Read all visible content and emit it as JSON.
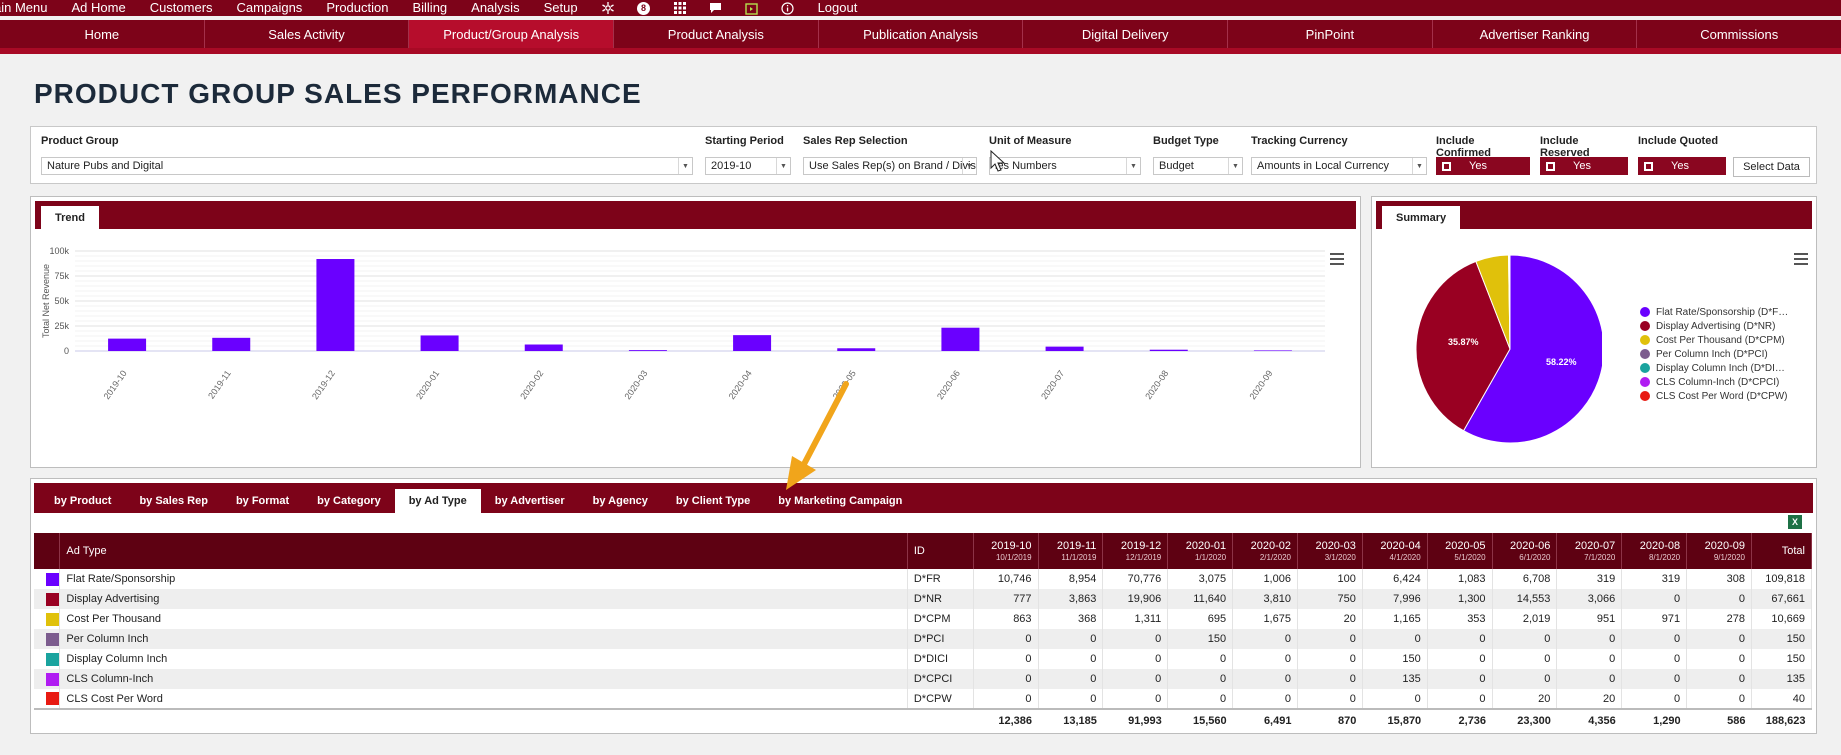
{
  "top_menu": {
    "items": [
      "ain Menu",
      "Ad Home",
      "Customers",
      "Campaigns",
      "Production",
      "Billing",
      "Analysis",
      "Setup"
    ],
    "badge_count": "8",
    "logout": "Logout"
  },
  "nav": {
    "tabs": [
      "Home",
      "Sales Activity",
      "Product/Group Analysis",
      "Product Analysis",
      "Publication Analysis",
      "Digital Delivery",
      "PinPoint",
      "Advertiser Ranking",
      "Commissions"
    ],
    "active": "Product/Group Analysis"
  },
  "page_title": "PRODUCT GROUP SALES PERFORMANCE",
  "filters": {
    "product_group": {
      "label": "Product Group",
      "value": "Nature Pubs and Digital"
    },
    "starting_period": {
      "label": "Starting Period",
      "value": "2019-10"
    },
    "sales_rep": {
      "label": "Sales Rep Selection",
      "value": "Use Sales Rep(s) on Brand / Divis"
    },
    "unit": {
      "label": "Unit of Measure",
      "value": "les Numbers"
    },
    "budget_type": {
      "label": "Budget Type",
      "value": "Budget"
    },
    "currency": {
      "label": "Tracking Currency",
      "value": "Amounts in Local Currency"
    },
    "include_confirmed": {
      "label": "Include Confirmed",
      "value": "Yes"
    },
    "include_reserved": {
      "label": "Include Reserved",
      "value": "Yes"
    },
    "include_quoted": {
      "label": "Include Quoted",
      "value": "Yes"
    },
    "select_data": "Select Data"
  },
  "trend": {
    "tab": "Trend",
    "bar_color": "#6a00ff"
  },
  "summary": {
    "tab": "Summary",
    "legend": [
      {
        "label": "Flat Rate/Sponsorship (D*F…",
        "color": "#6a00ff"
      },
      {
        "label": "Display Advertising (D*NR)",
        "color": "#990022"
      },
      {
        "label": "Cost Per Thousand (D*CPM)",
        "color": "#e0c10b"
      },
      {
        "label": "Per Column Inch (D*PCI)",
        "color": "#7c5c8e"
      },
      {
        "label": "Display Column Inch (D*DI…",
        "color": "#1aa39e"
      },
      {
        "label": "CLS Column-Inch (D*CPCI)",
        "color": "#b01cf2"
      },
      {
        "label": "CLS Cost Per Word (D*CPW)",
        "color": "#e81a12"
      }
    ],
    "pct_labels": [
      "35.87%",
      "58.22%"
    ]
  },
  "chart_data": [
    {
      "type": "bar",
      "title": "",
      "xlabel": "",
      "ylabel": "Total Net Revenue",
      "categories": [
        "2019-10",
        "2019-11",
        "2019-12",
        "2020-01",
        "2020-02",
        "2020-03",
        "2020-04",
        "2020-05",
        "2020-06",
        "2020-07",
        "2020-08",
        "2020-09"
      ],
      "values": [
        12386,
        13185,
        91993,
        15560,
        6491,
        870,
        15870,
        2736,
        23300,
        4356,
        1290,
        586
      ],
      "ylim": [
        0,
        100000
      ],
      "yticks": [
        "0",
        "25k",
        "50k",
        "75k",
        "100k"
      ],
      "grid": true
    },
    {
      "type": "pie",
      "labels": [
        "Flat Rate/Sponsorship",
        "Display Advertising",
        "Cost Per Thousand",
        "Per Column Inch",
        "Display Column Inch",
        "CLS Column-Inch",
        "CLS Cost Per Word"
      ],
      "values": [
        109818,
        67661,
        10669,
        150,
        150,
        135,
        40
      ]
    }
  ],
  "grid": {
    "tabs": [
      "by Product",
      "by Sales Rep",
      "by Format",
      "by Category",
      "by Ad Type",
      "by Advertiser",
      "by Agency",
      "by Client Type",
      "by Marketing Campaign"
    ],
    "active_tab": "by Ad Type",
    "headers": {
      "name": "Ad Type",
      "id": "ID",
      "total": "Total"
    },
    "periods": [
      {
        "p": "2019-10",
        "d": "10/1/2019"
      },
      {
        "p": "2019-11",
        "d": "11/1/2019"
      },
      {
        "p": "2019-12",
        "d": "12/1/2019"
      },
      {
        "p": "2020-01",
        "d": "1/1/2020"
      },
      {
        "p": "2020-02",
        "d": "2/1/2020"
      },
      {
        "p": "2020-03",
        "d": "3/1/2020"
      },
      {
        "p": "2020-04",
        "d": "4/1/2020"
      },
      {
        "p": "2020-05",
        "d": "5/1/2020"
      },
      {
        "p": "2020-06",
        "d": "6/1/2020"
      },
      {
        "p": "2020-07",
        "d": "7/1/2020"
      },
      {
        "p": "2020-08",
        "d": "8/1/2020"
      },
      {
        "p": "2020-09",
        "d": "9/1/2020"
      }
    ],
    "rows": [
      {
        "color": "#6a00ff",
        "name": "Flat Rate/Sponsorship",
        "id": "D*FR",
        "vals": [
          "10,746",
          "8,954",
          "70,776",
          "3,075",
          "1,006",
          "100",
          "6,424",
          "1,083",
          "6,708",
          "319",
          "319",
          "308"
        ],
        "total": "109,818"
      },
      {
        "color": "#990022",
        "name": "Display Advertising",
        "id": "D*NR",
        "vals": [
          "777",
          "3,863",
          "19,906",
          "11,640",
          "3,810",
          "750",
          "7,996",
          "1,300",
          "14,553",
          "3,066",
          "0",
          "0"
        ],
        "total": "67,661"
      },
      {
        "color": "#e0c10b",
        "name": "Cost Per Thousand",
        "id": "D*CPM",
        "vals": [
          "863",
          "368",
          "1,311",
          "695",
          "1,675",
          "20",
          "1,165",
          "353",
          "2,019",
          "951",
          "971",
          "278"
        ],
        "total": "10,669"
      },
      {
        "color": "#7c5c8e",
        "name": "Per Column Inch",
        "id": "D*PCI",
        "vals": [
          "0",
          "0",
          "0",
          "150",
          "0",
          "0",
          "0",
          "0",
          "0",
          "0",
          "0",
          "0"
        ],
        "total": "150"
      },
      {
        "color": "#1aa39e",
        "name": "Display Column Inch",
        "id": "D*DICI",
        "vals": [
          "0",
          "0",
          "0",
          "0",
          "0",
          "0",
          "150",
          "0",
          "0",
          "0",
          "0",
          "0"
        ],
        "total": "150"
      },
      {
        "color": "#b01cf2",
        "name": "CLS Column-Inch",
        "id": "D*CPCI",
        "vals": [
          "0",
          "0",
          "0",
          "0",
          "0",
          "0",
          "135",
          "0",
          "0",
          "0",
          "0",
          "0"
        ],
        "total": "135"
      },
      {
        "color": "#e81a12",
        "name": "CLS Cost Per Word",
        "id": "D*CPW",
        "vals": [
          "0",
          "0",
          "0",
          "0",
          "0",
          "0",
          "0",
          "0",
          "20",
          "20",
          "0",
          "0"
        ],
        "total": "40"
      }
    ],
    "totals": [
      "12,386",
      "13,185",
      "91,993",
      "15,560",
      "6,491",
      "870",
      "15,870",
      "2,736",
      "23,300",
      "4,356",
      "1,290",
      "586"
    ],
    "grand_total": "188,623"
  }
}
